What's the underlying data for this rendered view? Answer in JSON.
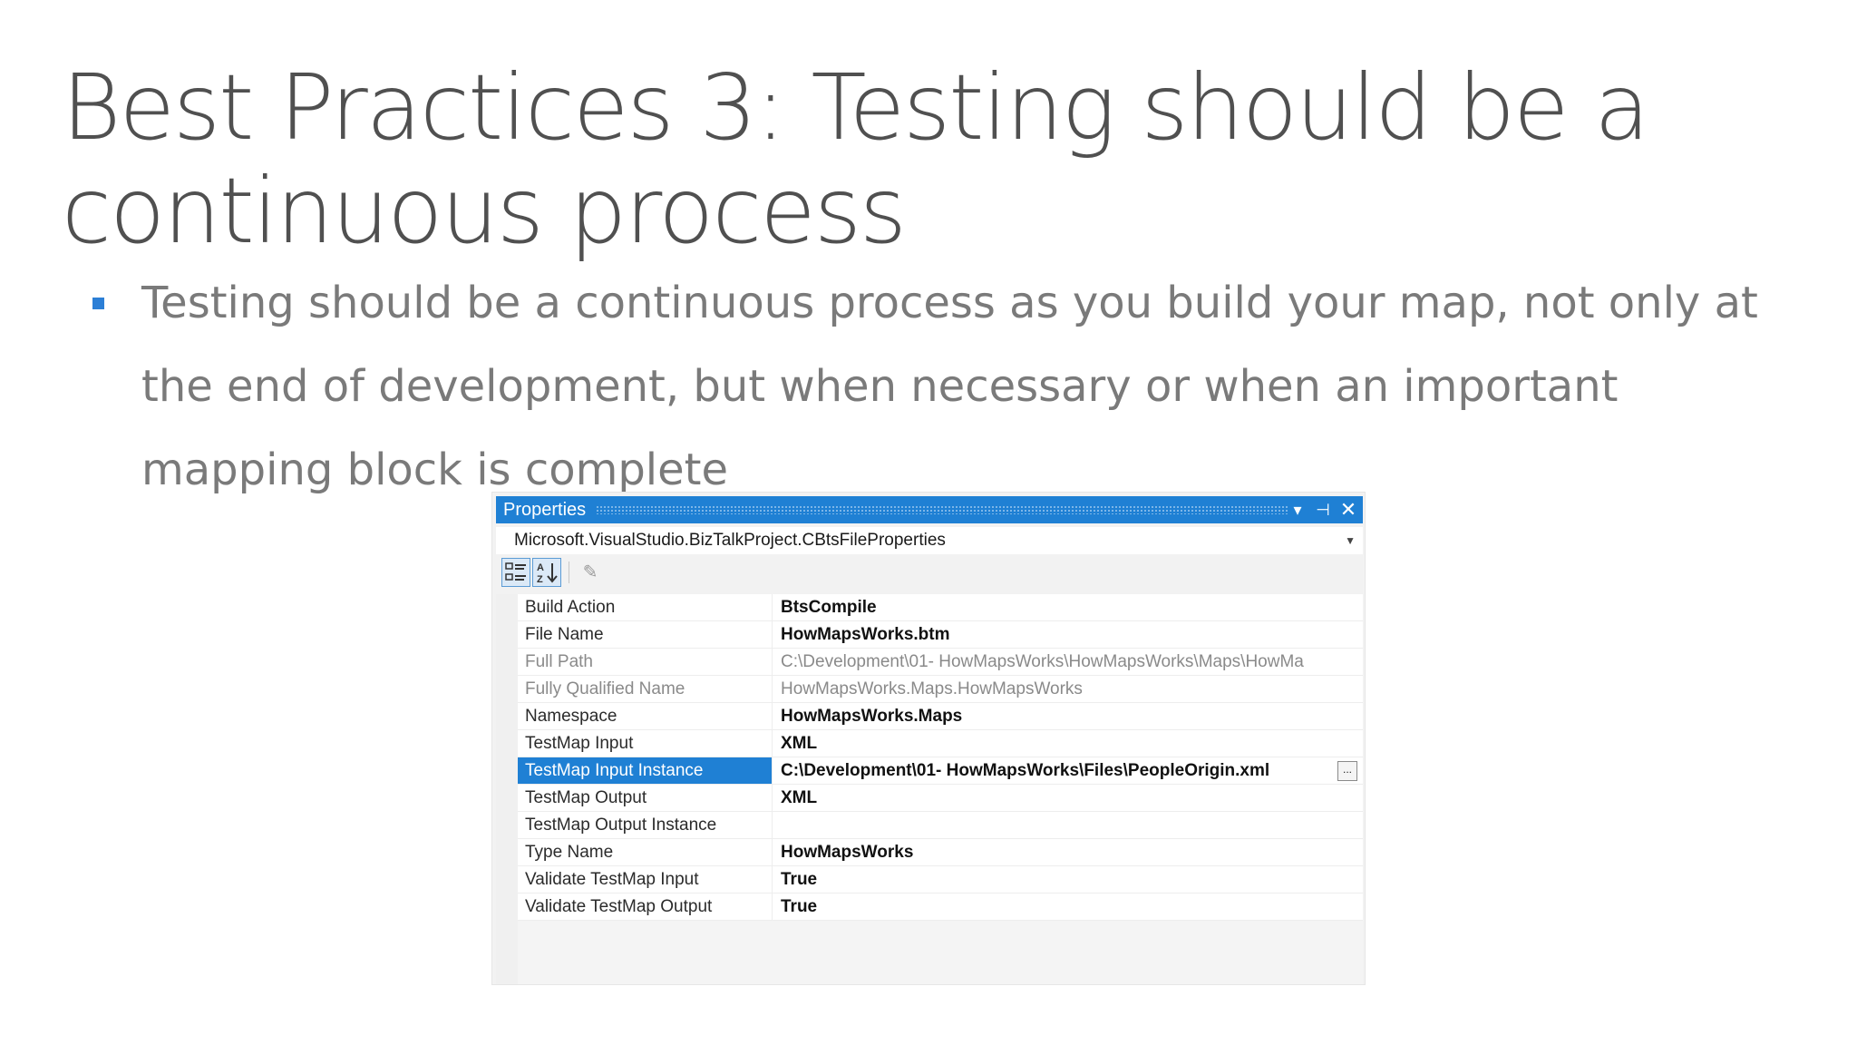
{
  "slide": {
    "title": "Best Practices 3: Testing should be a continuous process",
    "bullet": "Testing should be a continuous process as you build your map, not only at the end of development, but when necessary or when an important mapping block is complete"
  },
  "properties_window": {
    "title": "Properties",
    "object": "Microsoft.VisualStudio.BizTalkProject.CBtsFileProperties",
    "toolbar": {
      "categorized_icon": "categorized-icon",
      "alphabetical_icon": "alphabetical-icon",
      "property_pages_icon": "wrench-icon"
    },
    "rows": [
      {
        "name": "Build Action",
        "value": "BtsCompile"
      },
      {
        "name": "File Name",
        "value": "HowMapsWorks.btm"
      },
      {
        "name": "Full Path",
        "value": "C:\\Development\\01- HowMapsWorks\\HowMapsWorks\\Maps\\HowMa"
      },
      {
        "name": "Fully Qualified Name",
        "value": "HowMapsWorks.Maps.HowMapsWorks"
      },
      {
        "name": "Namespace",
        "value": "HowMapsWorks.Maps"
      },
      {
        "name": "TestMap Input",
        "value": "XML"
      },
      {
        "name": "TestMap Input Instance",
        "value": "C:\\Development\\01- HowMapsWorks\\Files\\PeopleOrigin.xml"
      },
      {
        "name": "TestMap Output",
        "value": "XML"
      },
      {
        "name": "TestMap Output Instance",
        "value": ""
      },
      {
        "name": "Type Name",
        "value": "HowMapsWorks"
      },
      {
        "name": "Validate TestMap Input",
        "value": "True"
      },
      {
        "name": "Validate TestMap Output",
        "value": "True"
      }
    ],
    "ellipsis_label": "...",
    "colors": {
      "accent": "#1f80d4",
      "bullet": "#2c7fd6"
    }
  }
}
